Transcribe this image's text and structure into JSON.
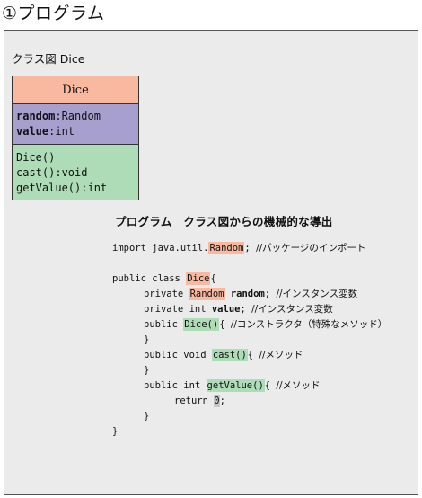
{
  "heading": "①プログラム",
  "class_diagram_label": "クラス図 Dice",
  "uml": {
    "class_name": "Dice",
    "attributes": [
      {
        "name": "random",
        "type": ":Random"
      },
      {
        "name": "value",
        "type": ":int"
      }
    ],
    "operations": [
      "Dice()",
      "cast():void",
      "getValue():int"
    ]
  },
  "program_title": "プログラム　クラス図からの機械的な導出",
  "code": {
    "import_kw": "import java.util.",
    "import_cls": "Random",
    "import_end": ";",
    "import_comment": "//パッケージのインポート",
    "class_decl": "public class ",
    "class_name": "Dice",
    "class_open": "{",
    "field1_mod": "private ",
    "field1_type": "Random",
    "field1_name": "random",
    "field1_end": ";",
    "field1_comment": "//インスタンス変数",
    "field2_mod": "private int ",
    "field2_name": "value",
    "field2_end": ";",
    "field2_comment": "//インスタンス変数",
    "ctor_mod": "public ",
    "ctor_name": "Dice()",
    "ctor_open": "{",
    "ctor_comment": "//コンストラクタ（特殊なメソッド）",
    "close1": "}",
    "cast_mod": "public void ",
    "cast_name": "cast()",
    "cast_open": "{",
    "cast_comment": "//メソッド",
    "close2": "}",
    "get_mod": "public int ",
    "get_name": "getValue()",
    "get_open": "{",
    "get_comment": "//メソッド",
    "return_kw": "return ",
    "return_val": "0",
    "return_end": ";",
    "close3": "}",
    "class_close": "}"
  },
  "colors": {
    "class_name_fill": "#f8b9a0",
    "attributes_fill": "#a79fce",
    "operations_fill": "#aedcb6",
    "panel_fill": "#ebebeb"
  }
}
